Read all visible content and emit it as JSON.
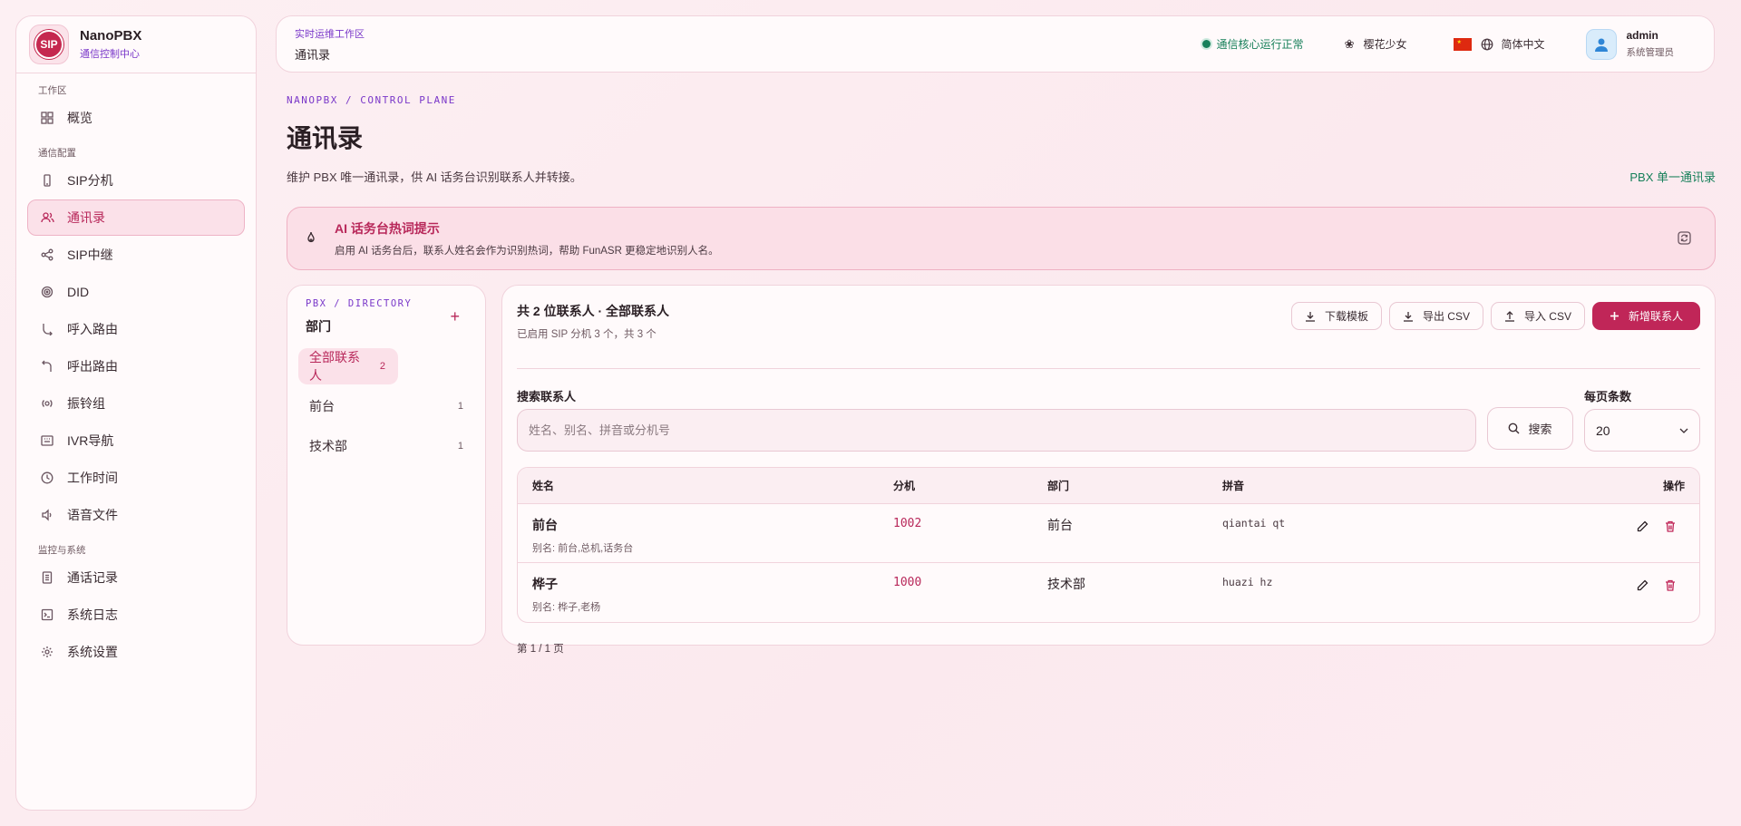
{
  "brand": {
    "logo_text": "SIP",
    "name": "NanoPBX",
    "subtitle": "通信控制中心"
  },
  "sidebar": {
    "sections": [
      {
        "label": "工作区",
        "items": [
          {
            "label": "概览",
            "icon": "grid-icon"
          }
        ]
      },
      {
        "label": "通信配置",
        "items": [
          {
            "label": "SIP分机",
            "icon": "phone-icon"
          },
          {
            "label": "通讯录",
            "icon": "users-icon",
            "active": true
          },
          {
            "label": "SIP中继",
            "icon": "share-icon"
          },
          {
            "label": "DID",
            "icon": "target-icon"
          },
          {
            "label": "呼入路由",
            "icon": "call-in-icon"
          },
          {
            "label": "呼出路由",
            "icon": "call-out-icon"
          },
          {
            "label": "振铃组",
            "icon": "ring-icon"
          },
          {
            "label": "IVR导航",
            "icon": "keypad-icon"
          },
          {
            "label": "工作时间",
            "icon": "clock-icon"
          },
          {
            "label": "语音文件",
            "icon": "speaker-icon"
          }
        ]
      },
      {
        "label": "监控与系统",
        "items": [
          {
            "label": "通话记录",
            "icon": "document-icon"
          },
          {
            "label": "系统日志",
            "icon": "terminal-icon"
          },
          {
            "label": "系统设置",
            "icon": "gear-icon"
          }
        ]
      }
    ]
  },
  "topbar": {
    "eyebrow": "实时运维工作区",
    "title": "通讯录",
    "status": "通信核心运行正常",
    "theme": "樱花少女",
    "language": "简体中文",
    "user": {
      "name": "admin",
      "role": "系统管理员"
    }
  },
  "page": {
    "eyebrow": "NANOPBX / CONTROL PLANE",
    "title": "通讯录",
    "description": "维护 PBX 唯一通讯录，供 AI 话务台识别联系人并转接。",
    "tag": "PBX 单一通讯录"
  },
  "hint": {
    "title": "AI 话务台热词提示",
    "text": "启用 AI 话务台后，联系人姓名会作为识别热词，帮助 FunASR 更稳定地识别人名。"
  },
  "departments": {
    "eyebrow": "PBX / DIRECTORY",
    "title": "部门",
    "add": "+",
    "items": [
      {
        "label": "全部联系人",
        "count": "2"
      },
      {
        "label": "前台",
        "count": "1"
      },
      {
        "label": "技术部",
        "count": "1"
      }
    ]
  },
  "contacts": {
    "summary": "共 2 位联系人 · 全部联系人",
    "sub": "已启用 SIP 分机 3 个，共 3 个",
    "actions": {
      "download_template": "下载模板",
      "export_csv": "导出 CSV",
      "import_csv": "导入 CSV",
      "add_contact": "新增联系人"
    },
    "search_label": "搜索联系人",
    "search_placeholder": "姓名、别名、拼音或分机号",
    "search_button": "搜索",
    "per_page_label": "每页条数",
    "per_page_value": "20",
    "columns": {
      "name": "姓名",
      "ext": "分机",
      "dept": "部门",
      "pinyin": "拼音",
      "ops": "操作"
    },
    "rows": [
      {
        "name": "前台",
        "alias": "别名: 前台,总机,话务台",
        "ext": "1002",
        "dept": "前台",
        "pinyin": "qiantai qt"
      },
      {
        "name": "桦子",
        "alias": "别名: 桦子,老杨",
        "ext": "1000",
        "dept": "技术部",
        "pinyin": "huazi hz"
      }
    ],
    "pager": "第 1 / 1 页"
  },
  "colors": {
    "accent": "#c02658",
    "status": "#17805a",
    "eyebrow": "#7a38c9"
  }
}
